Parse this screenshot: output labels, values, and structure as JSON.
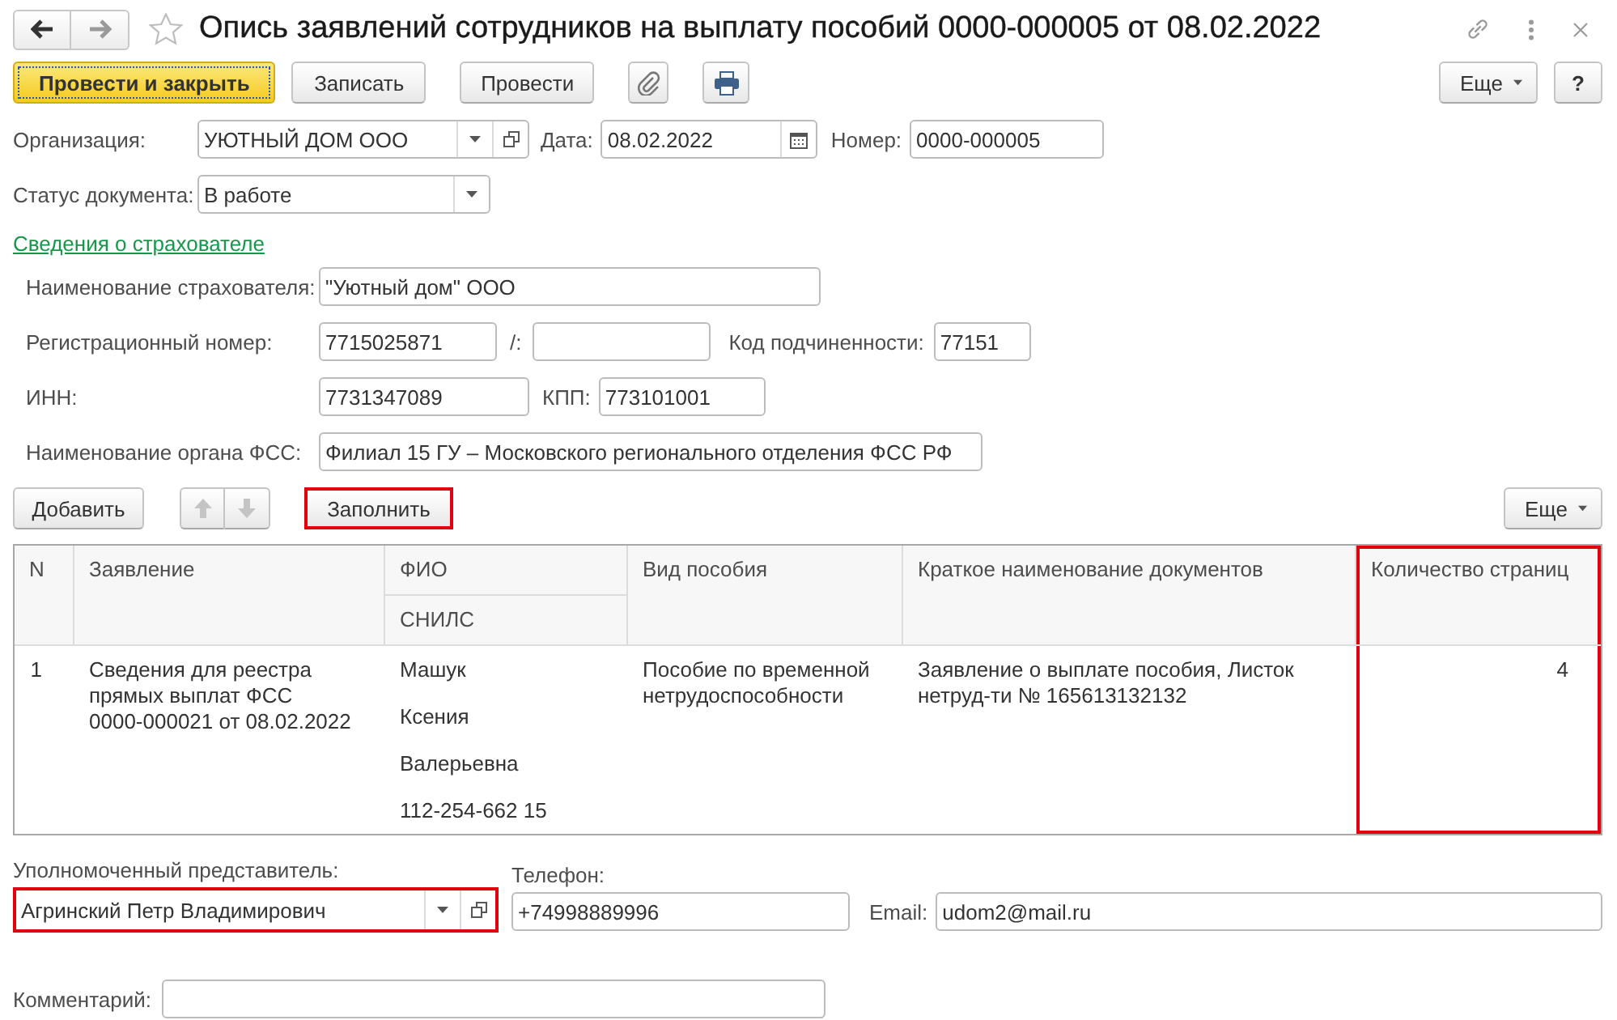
{
  "window": {
    "title": "Опись заявлений сотрудников на выплату пособий 0000-000005 от 08.02.2022",
    "favorite": false
  },
  "command_bar": {
    "buttons": [
      {
        "kind": "default",
        "label": "Провести и закрыть"
      },
      {
        "kind": "text",
        "label": "Записать"
      },
      {
        "kind": "text",
        "label": "Провести"
      },
      {
        "kind": "attach"
      },
      {
        "kind": "print"
      }
    ],
    "more": "Еще",
    "help": "?"
  },
  "header": {
    "organization": {
      "label": "Организация:",
      "value": "УЮТНЫЙ ДОМ ООО"
    },
    "date": {
      "label": "Дата:",
      "value": "08.02.2022"
    },
    "number": {
      "label": "Номер:",
      "value": "0000-000005"
    },
    "status": {
      "label": "Статус документа:",
      "value": "В работе"
    }
  },
  "insurer": {
    "link": "Сведения о страхователе",
    "name": {
      "label": "Наименование страхователя:",
      "value": "\"Уютный дом\" ООО"
    },
    "reg_number": {
      "label": "Регистрационный номер:",
      "value": "7715025871"
    },
    "reg_suffix": {
      "label": "/:"
    },
    "subordination_code": {
      "label": "Код подчиненности:",
      "value": "77151"
    },
    "inn": {
      "label": "ИНН:",
      "value": "7731347089"
    },
    "kpp": {
      "label": "КПП:",
      "value": "773101001"
    },
    "fss_body": {
      "label": "Наименование органа ФСС:",
      "value": "Филиал 15 ГУ – Московского регионального отделения ФСС РФ"
    }
  },
  "table_toolbar": {
    "add": "Добавить",
    "move_up": {
      "disabled": true
    },
    "move_down": {
      "disabled": true
    },
    "fill": {
      "label": "Заполнить",
      "highlighted": true
    },
    "more": "Еще"
  },
  "table": {
    "columns": [
      {
        "label": "N",
        "highlighted": false
      },
      {
        "label": "Заявление",
        "highlighted": false
      },
      {
        "label": "ФИО",
        "sublabel": "СНИЛС",
        "highlighted": false
      },
      {
        "label": "Вид пособия",
        "highlighted": false
      },
      {
        "label": "Краткое наименование документов",
        "highlighted": false
      },
      {
        "label": "Количество страниц",
        "highlighted": true
      }
    ],
    "rows": [
      {
        "n": "1",
        "application": "Сведения для реестра прямых выплат ФСС 0000-000021 от 08.02.2022",
        "last_name": "Машук",
        "first_name": "Ксения",
        "middle_name": "Валерьевна",
        "snils": "112-254-662 15",
        "benefit_type": "Пособие по временной нетрудоспособности",
        "documents": "Заявление о выплате пособия, Листок нетруд-ти № 165613132132",
        "pages": "4"
      }
    ]
  },
  "representative": {
    "label": "Уполномоченный представитель:",
    "value": "Агринский Петр Владимирович",
    "highlighted": true
  },
  "phone": {
    "label": "Телефон:",
    "value": "+74998889996"
  },
  "email": {
    "label": "Email:",
    "value": "udom2@mail.ru"
  },
  "comment": {
    "label": "Комментарий:"
  }
}
